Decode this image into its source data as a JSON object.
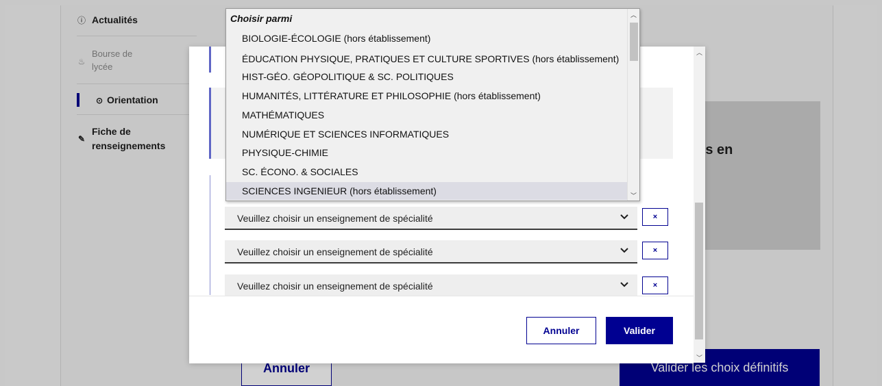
{
  "sidebar": {
    "items": [
      {
        "icon": "info-circle-icon",
        "label": "Actualités",
        "active": false,
        "muted": false
      },
      {
        "icon": "wallet-hand-icon",
        "label": "Bourse de lycée",
        "line1": "Bourse de",
        "line2": "lycée",
        "active": false,
        "muted": true
      },
      {
        "icon": "compass-icon",
        "label": "Orientation",
        "active": true,
        "muted": false
      },
      {
        "icon": "pen-square-icon",
        "label": "Fiche de renseignements",
        "line1": "Fiche de",
        "line2": "renseignements",
        "active": false,
        "muted": false
      }
    ]
  },
  "background": {
    "heading_fragment": "ris en",
    "annuler_label": "Annuler",
    "valider_label": "Valider les choix définitifs"
  },
  "dropdown": {
    "header": "Choisir parmi",
    "options": [
      "BIOLOGIE-ÉCOLOGIE (hors établissement)",
      "ÉDUCATION PHYSIQUE, PRATIQUES ET CULTURE SPORTIVES (hors établissement)",
      "HIST-GÉO. GÉOPOLITIQUE & SC. POLITIQUES",
      "HUMANITÉS, LITTÉRATURE ET PHILOSOPHIE (hors établissement)",
      "MATHÉMATIQUES",
      "NUMÉRIQUE ET SCIENCES INFORMATIQUES",
      "PHYSIQUE-CHIMIE",
      "SC. ÉCONO. & SOCIALES",
      "SCIENCES INGENIEUR (hors établissement)"
    ],
    "highlighted_index": 8
  },
  "modal": {
    "selects": [
      {
        "value": "Veuillez choisir un enseignement de spécialité"
      },
      {
        "value": "Veuillez choisir un enseignement de spécialité"
      },
      {
        "value": "Veuillez choisir un enseignement de spécialité"
      }
    ],
    "remove_label": "×",
    "annuler_label": "Annuler",
    "valider_label": "Valider"
  },
  "colors": {
    "primary": "#000091",
    "accent_bar": "#5f66c5",
    "highlight": "#dcdce4"
  }
}
